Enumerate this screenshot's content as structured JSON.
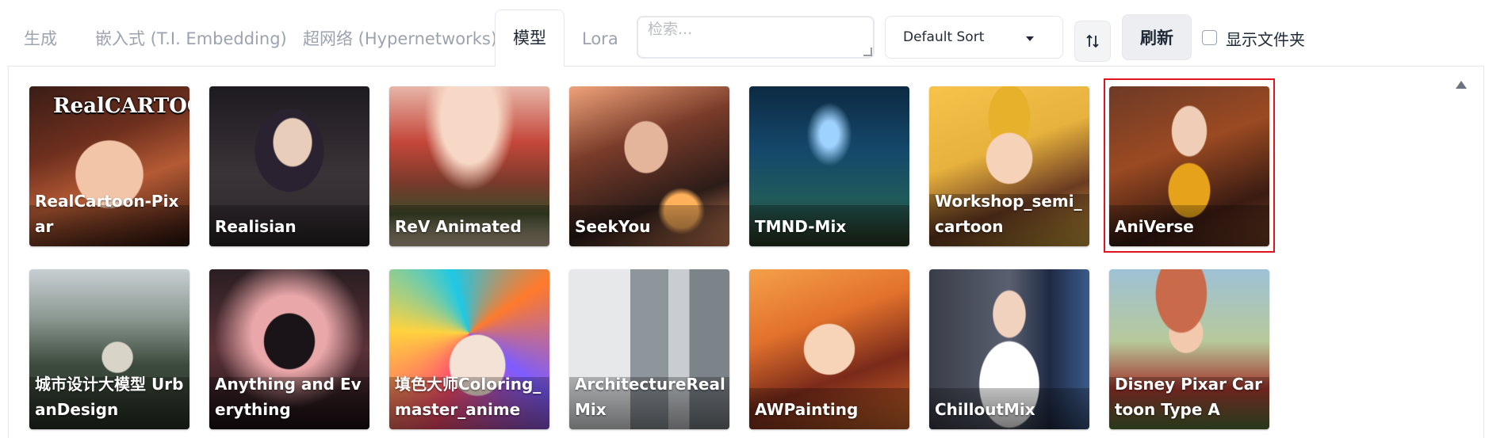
{
  "tabs": [
    {
      "label": "生成"
    },
    {
      "label": "嵌入式 (T.I. Embedding)"
    },
    {
      "label": "超网络 (Hypernetworks)"
    },
    {
      "label": "模型",
      "active": true
    },
    {
      "label": "Lora"
    }
  ],
  "search": {
    "placeholder": "检索..."
  },
  "sort": {
    "selected": "Default Sort"
  },
  "refresh_label": "刷新",
  "show_folders_label": "显示文件夹",
  "selected_model": "AniVerse",
  "models": [
    {
      "name": "RealCartoon-Pixar",
      "logo": "RealCARTOON"
    },
    {
      "name": "Realisian"
    },
    {
      "name": "ReV Animated"
    },
    {
      "name": "SeekYou"
    },
    {
      "name": "TMND-Mix"
    },
    {
      "name": "Workshop_semi_cartoon"
    },
    {
      "name": "AniVerse"
    },
    {
      "name": "城市设计大模型 UrbanDesign"
    },
    {
      "name": "Anything and Everything"
    },
    {
      "name": "填色大师Coloring_master_anime"
    },
    {
      "name": "ArchitectureRealMix"
    },
    {
      "name": "AWPainting"
    },
    {
      "name": "ChilloutMix"
    },
    {
      "name": "Disney Pixar Cartoon Type A"
    }
  ],
  "colors": {
    "selected_border": "#e0141f",
    "tab_inactive": "#9ca3af"
  }
}
